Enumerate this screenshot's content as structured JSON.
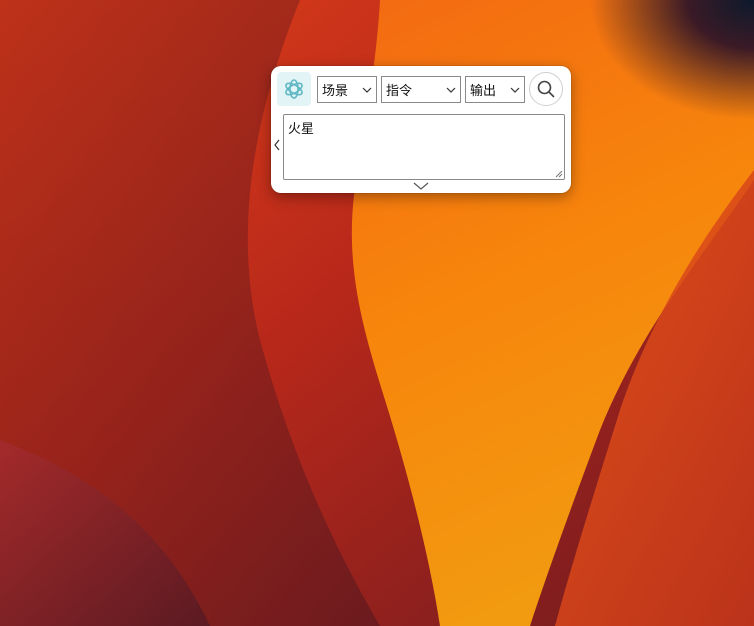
{
  "widget": {
    "logo_icon": "openai-logo-icon",
    "scene_select": {
      "value": "场景",
      "icon": "chevron-down-icon"
    },
    "command_select": {
      "value": "指令",
      "icon": "chevron-down-icon"
    },
    "output_select": {
      "value": "输出",
      "icon": "chevron-down-icon"
    },
    "search_icon": "search-icon",
    "collapse_icon": "chevron-left-icon",
    "prompt": {
      "value": "火星"
    },
    "expand_icon": "chevron-down-icon"
  },
  "colors": {
    "logo_tint": "#5fb8c4",
    "logo_bg": "#e3f4f6",
    "wallpaper_dark": "#5a1a22",
    "wallpaper_red": "#c93a1a",
    "wallpaper_orange": "#f48a10"
  }
}
